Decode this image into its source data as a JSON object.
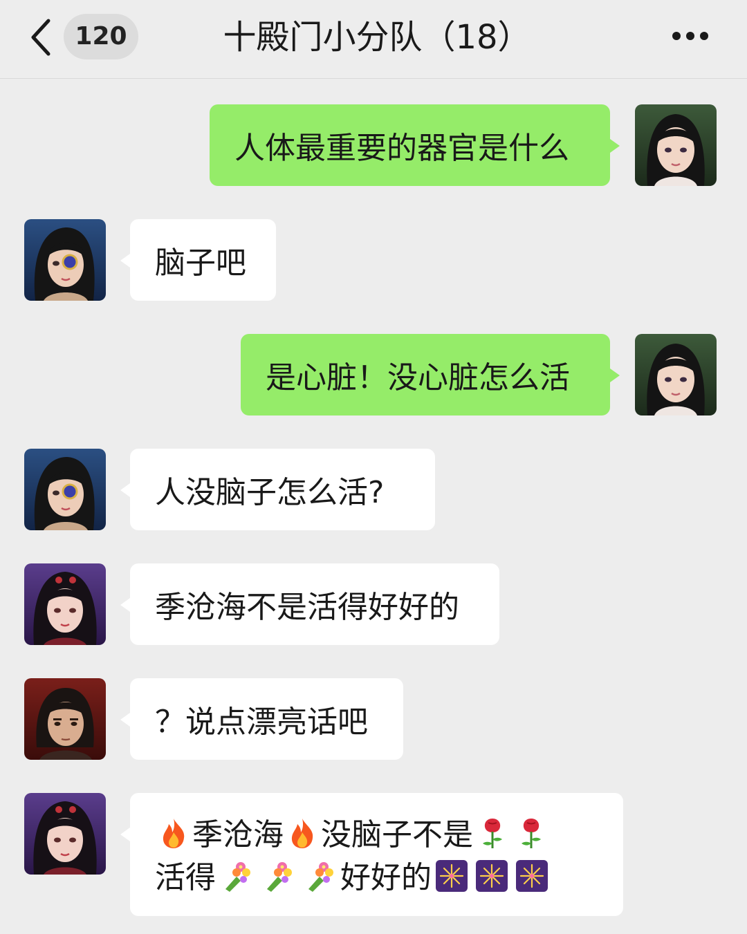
{
  "header": {
    "unread_count": "120",
    "title": "十殿门小分队（18）"
  },
  "messages": [
    {
      "text": "人体最重要的器官是什么"
    },
    {
      "text": "脑子吧"
    },
    {
      "text": "是心脏！没心脏怎么活"
    },
    {
      "text": "人没脑子怎么活?"
    },
    {
      "text": "季沧海不是活得好好的"
    },
    {
      "text": "？说点漂亮话吧"
    },
    {
      "line1_a": "季沧海",
      "line1_b": "没脑子不是",
      "line2_a": "活得",
      "line2_b": "好好的"
    }
  ],
  "icons": {
    "back": "chevron-left-icon",
    "more": "more-dots-icon",
    "fire": "fire-emoji",
    "rose": "rose-emoji",
    "bouquet": "bouquet-emoji",
    "fireworks": "fireworks-emoji"
  },
  "colors": {
    "outgoing_bubble": "#95ec69",
    "incoming_bubble": "#ffffff",
    "background": "#ededed"
  }
}
